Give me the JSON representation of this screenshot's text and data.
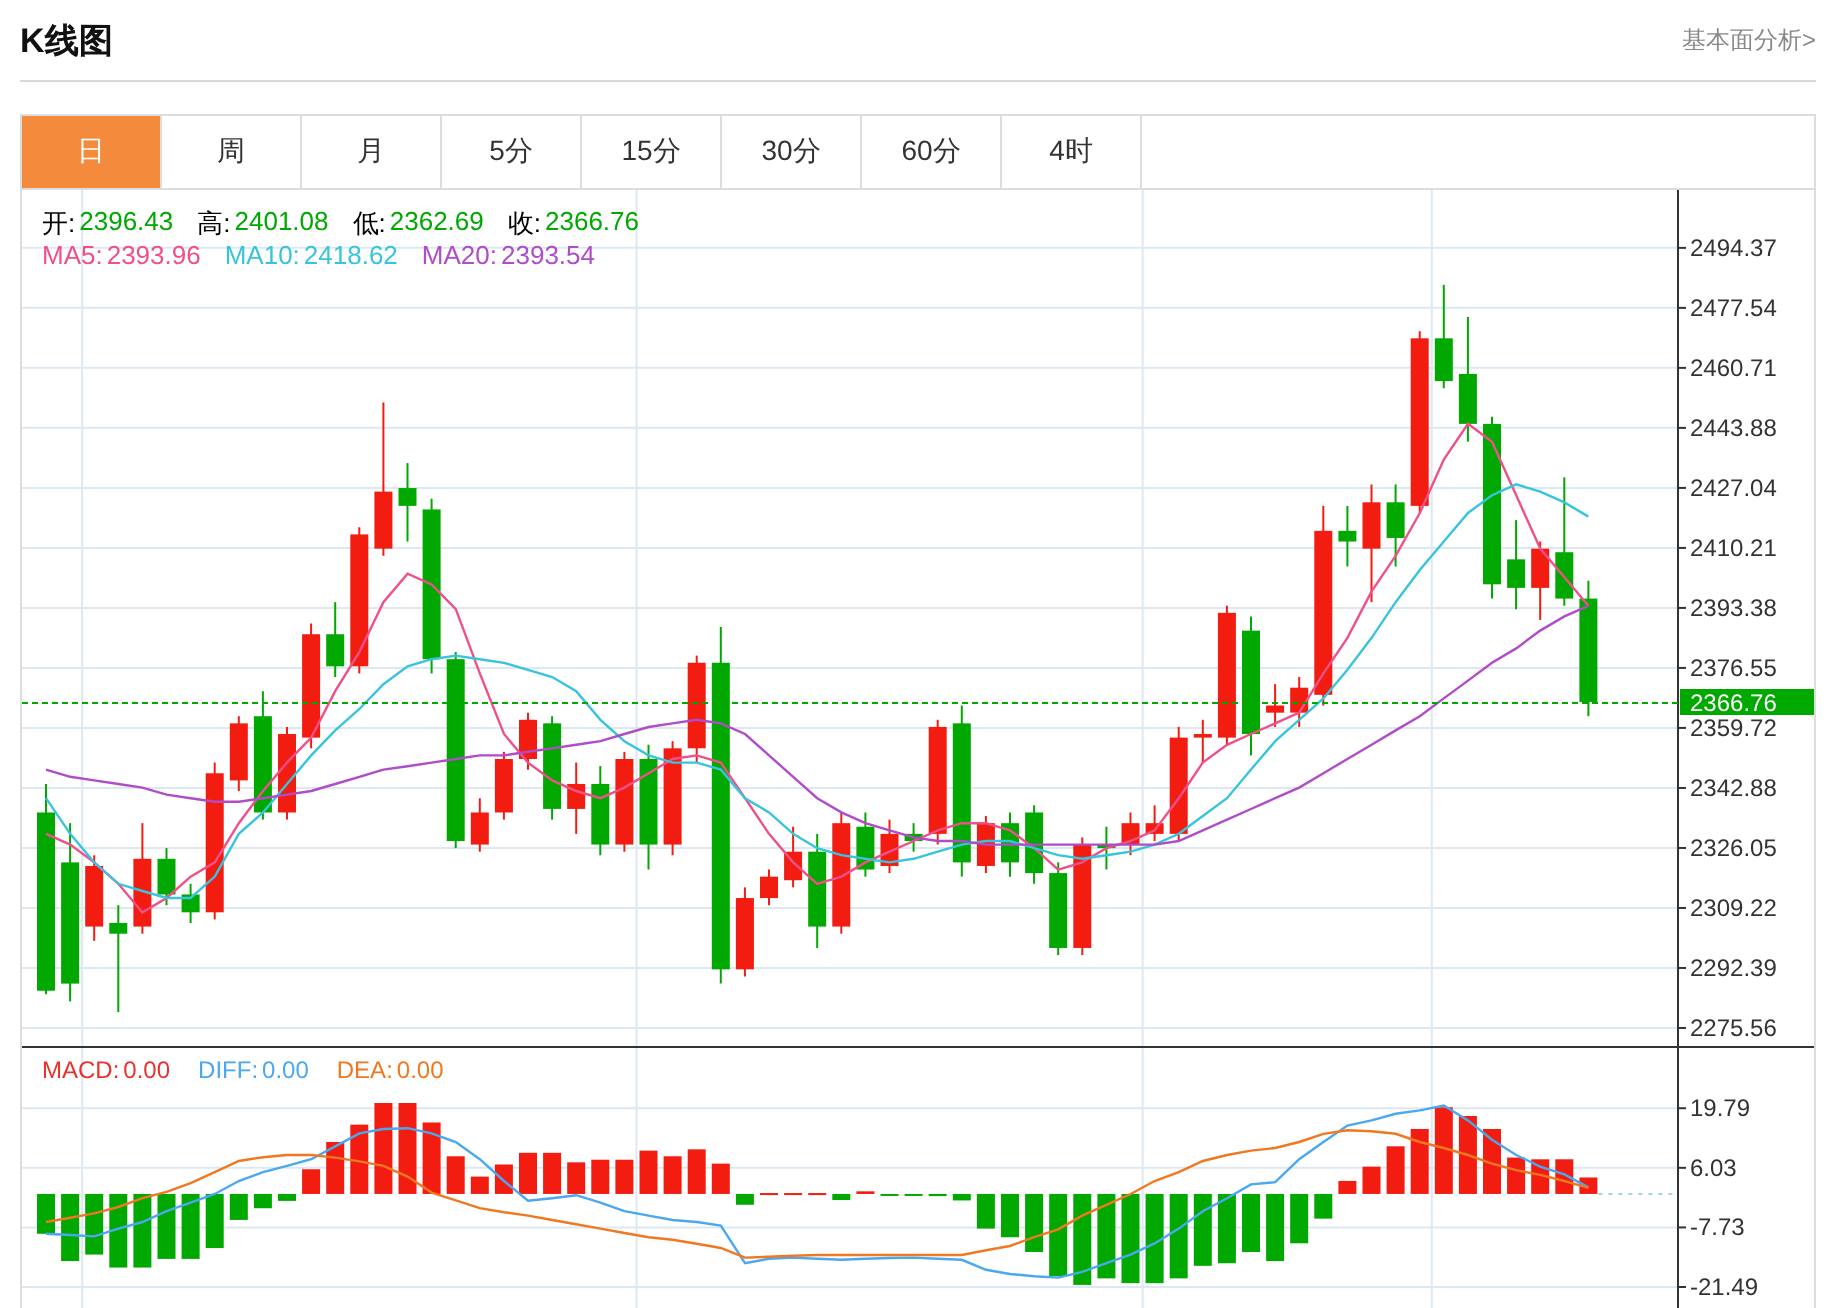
{
  "header": {
    "title": "K线图",
    "link": "基本面分析>"
  },
  "tabs": [
    {
      "label": "日",
      "selected": true
    },
    {
      "label": "周",
      "selected": false
    },
    {
      "label": "月",
      "selected": false
    },
    {
      "label": "5分",
      "selected": false
    },
    {
      "label": "15分",
      "selected": false
    },
    {
      "label": "30分",
      "selected": false
    },
    {
      "label": "60分",
      "selected": false
    },
    {
      "label": "4时",
      "selected": false
    }
  ],
  "price_panel": {
    "ohlc": [
      {
        "label": "开:",
        "value": "2396.43"
      },
      {
        "label": "高:",
        "value": "2401.08"
      },
      {
        "label": "低:",
        "value": "2362.69"
      },
      {
        "label": "收:",
        "value": "2366.76"
      }
    ],
    "ma_legend": [
      {
        "label": "MA5:",
        "value": "2393.96",
        "color": "#f0508a"
      },
      {
        "label": "MA10:",
        "value": "2418.62",
        "color": "#38c4dc"
      },
      {
        "label": "MA20:",
        "value": "2393.54",
        "color": "#b04cc8"
      }
    ],
    "chart_data": {
      "type": "candlestick",
      "grid": true,
      "ylim": [
        2270.5,
        2510.6
      ],
      "yticks": [
        {
          "value": 2494.37,
          "label": "2494.37"
        },
        {
          "value": 2477.54,
          "label": "2477.54"
        },
        {
          "value": 2460.71,
          "label": "2460.71"
        },
        {
          "value": 2443.88,
          "label": "2443.88"
        },
        {
          "value": 2427.04,
          "label": "2427.04"
        },
        {
          "value": 2410.21,
          "label": "2410.21"
        },
        {
          "value": 2393.38,
          "label": "2393.38"
        },
        {
          "value": 2376.55,
          "label": "2376.55"
        },
        {
          "value": 2359.72,
          "label": "2359.72"
        },
        {
          "value": 2342.88,
          "label": "2342.88"
        },
        {
          "value": 2326.05,
          "label": "2326.05"
        },
        {
          "value": 2309.22,
          "label": "2309.22"
        },
        {
          "value": 2292.39,
          "label": "2292.39"
        },
        {
          "value": 2275.56,
          "label": "2275.56"
        }
      ],
      "ref_lines": [
        {
          "axis": "y",
          "value": 2366.76,
          "label": "2366.76",
          "color": "#00a800"
        }
      ],
      "ohlc": [
        [
          2336,
          2344,
          2285,
          2286
        ],
        [
          2322,
          2333,
          2283,
          2288
        ],
        [
          2304,
          2324,
          2300,
          2321
        ],
        [
          2305,
          2310,
          2280,
          2302
        ],
        [
          2304,
          2333,
          2302,
          2323
        ],
        [
          2323,
          2326,
          2310,
          2313
        ],
        [
          2313,
          2316,
          2305,
          2308
        ],
        [
          2308,
          2350,
          2306,
          2347
        ],
        [
          2345,
          2363,
          2342,
          2361
        ],
        [
          2363,
          2370,
          2334,
          2336
        ],
        [
          2336,
          2360,
          2334,
          2358
        ],
        [
          2357,
          2389,
          2354,
          2386
        ],
        [
          2386,
          2395,
          2374,
          2377
        ],
        [
          2377,
          2416,
          2375,
          2414
        ],
        [
          2410,
          2451,
          2408,
          2426
        ],
        [
          2427,
          2434,
          2412,
          2422
        ],
        [
          2421,
          2424,
          2375,
          2379
        ],
        [
          2379,
          2381,
          2326,
          2328
        ],
        [
          2327,
          2340,
          2325,
          2336
        ],
        [
          2336,
          2353,
          2334,
          2351
        ],
        [
          2351,
          2364,
          2348,
          2362
        ],
        [
          2361,
          2363,
          2334,
          2337
        ],
        [
          2337,
          2350,
          2330,
          2344
        ],
        [
          2344,
          2349,
          2324,
          2327
        ],
        [
          2327,
          2353,
          2325,
          2351
        ],
        [
          2351,
          2355,
          2320,
          2327
        ],
        [
          2327,
          2356,
          2324,
          2354
        ],
        [
          2354,
          2380,
          2350,
          2378
        ],
        [
          2378,
          2388,
          2288,
          2292
        ],
        [
          2292,
          2315,
          2290,
          2312
        ],
        [
          2312,
          2320,
          2310,
          2318
        ],
        [
          2317,
          2332,
          2315,
          2325
        ],
        [
          2325,
          2330,
          2298,
          2304
        ],
        [
          2304,
          2336,
          2302,
          2333
        ],
        [
          2332,
          2336,
          2318,
          2320
        ],
        [
          2321,
          2334,
          2319,
          2330
        ],
        [
          2330,
          2333,
          2325,
          2328
        ],
        [
          2330,
          2362,
          2327,
          2360
        ],
        [
          2361,
          2366,
          2318,
          2322
        ],
        [
          2321,
          2335,
          2319,
          2333
        ],
        [
          2333,
          2336,
          2318,
          2322
        ],
        [
          2336,
          2338,
          2316,
          2319
        ],
        [
          2319,
          2322,
          2296,
          2298
        ],
        [
          2298,
          2329,
          2296,
          2327
        ],
        [
          2327,
          2332,
          2320,
          2326
        ],
        [
          2327,
          2336,
          2324,
          2333
        ],
        [
          2330,
          2338,
          2328,
          2333
        ],
        [
          2330,
          2360,
          2328,
          2357
        ],
        [
          2357,
          2362,
          2350,
          2358
        ],
        [
          2357,
          2394,
          2355,
          2392
        ],
        [
          2387,
          2391,
          2352,
          2358
        ],
        [
          2364,
          2372,
          2360,
          2366
        ],
        [
          2364,
          2374,
          2360,
          2371
        ],
        [
          2369,
          2422,
          2366,
          2415
        ],
        [
          2415,
          2422,
          2405,
          2412
        ],
        [
          2410,
          2428,
          2395,
          2423
        ],
        [
          2423,
          2428,
          2405,
          2413
        ],
        [
          2422,
          2471,
          2420,
          2469
        ],
        [
          2469,
          2484,
          2455,
          2457
        ],
        [
          2459,
          2475,
          2440,
          2445
        ],
        [
          2445,
          2447,
          2396,
          2400
        ],
        [
          2407,
          2418,
          2393,
          2399
        ],
        [
          2399,
          2412,
          2390,
          2410
        ],
        [
          2409,
          2430,
          2394,
          2396
        ],
        [
          2396,
          2401,
          2363,
          2367
        ]
      ],
      "series": [
        {
          "type": "line",
          "color": "#f0508a",
          "values": [
            2330,
            2327,
            2322,
            2316,
            2308,
            2312,
            2318,
            2322,
            2333,
            2342,
            2350,
            2357,
            2370,
            2381,
            2395,
            2403,
            2400,
            2393,
            2375,
            2358,
            2350,
            2345,
            2342,
            2340,
            2343,
            2347,
            2351,
            2352,
            2350,
            2340,
            2330,
            2322,
            2316,
            2318,
            2322,
            2325,
            2328,
            2331,
            2333,
            2333,
            2331,
            2326,
            2320,
            2322,
            2326,
            2328,
            2331,
            2340,
            2350,
            2355,
            2358,
            2361,
            2364,
            2375,
            2385,
            2398,
            2408,
            2420,
            2435,
            2445,
            2440,
            2425,
            2410,
            2402,
            2394
          ]
        },
        {
          "type": "line",
          "color": "#38c4dc",
          "values": [
            2340,
            2330,
            2322,
            2316,
            2314,
            2312,
            2312,
            2318,
            2330,
            2336,
            2344,
            2352,
            2359,
            2365,
            2372,
            2377,
            2379,
            2380,
            2379,
            2378,
            2376,
            2374,
            2370,
            2362,
            2356,
            2352,
            2350,
            2350,
            2348,
            2340,
            2336,
            2330,
            2326,
            2324,
            2323,
            2322,
            2323,
            2325,
            2327,
            2328,
            2328,
            2326,
            2324,
            2323,
            2324,
            2325,
            2327,
            2330,
            2335,
            2340,
            2348,
            2356,
            2362,
            2368,
            2376,
            2385,
            2395,
            2404,
            2412,
            2420,
            2425,
            2428,
            2426,
            2423,
            2419
          ]
        },
        {
          "type": "line",
          "color": "#b04cc8",
          "values": [
            2348,
            2346,
            2345,
            2344,
            2343,
            2341,
            2340,
            2339,
            2339,
            2340,
            2341,
            2342,
            2344,
            2346,
            2348,
            2349,
            2350,
            2351,
            2352,
            2352,
            2353,
            2354,
            2355,
            2356,
            2358,
            2360,
            2361,
            2362,
            2361,
            2358,
            2352,
            2346,
            2340,
            2336,
            2333,
            2331,
            2329,
            2328,
            2328,
            2327,
            2327,
            2327,
            2327,
            2327,
            2327,
            2327,
            2327,
            2328,
            2331,
            2334,
            2337,
            2340,
            2343,
            2347,
            2351,
            2355,
            2359,
            2363,
            2368,
            2373,
            2378,
            2382,
            2387,
            2391,
            2394
          ]
        }
      ]
    }
  },
  "macd_panel": {
    "legend": [
      {
        "label": "MACD:",
        "value": "0.00",
        "color": "#e8322b"
      },
      {
        "label": "DIFF:",
        "value": "0.00",
        "color": "#4aa8f0"
      },
      {
        "label": "DEA:",
        "value": "0.00",
        "color": "#f07820"
      }
    ],
    "chart_data": {
      "type": "bar",
      "grid": true,
      "ylim": [
        -26.8,
        33.7
      ],
      "yticks": [
        {
          "value": 19.79,
          "label": "19.79"
        },
        {
          "value": 6.03,
          "label": "6.03"
        },
        {
          "value": -7.73,
          "label": "-7.73"
        },
        {
          "value": -21.49,
          "label": "-21.49"
        }
      ],
      "series": [
        {
          "colors": [
            "#00a800",
            "#00a800",
            "#00a800",
            "#00a800",
            "#00a800",
            "#00a800",
            "#00a800",
            "#00a800",
            "#00a800",
            "#00a800",
            "#00a800",
            "#f21c10",
            "#f21c10",
            "#f21c10",
            "#f21c10",
            "#f21c10",
            "#f21c10",
            "#f21c10",
            "#f21c10",
            "#f21c10",
            "#f21c10",
            "#f21c10",
            "#f21c10",
            "#f21c10",
            "#f21c10",
            "#f21c10",
            "#f21c10",
            "#f21c10",
            "#f21c10",
            "#00a800",
            "#f21c10",
            "#f21c10",
            "#f21c10",
            "#00a800",
            "#f21c10",
            "#00a800",
            "#00a800",
            "#00a800",
            "#00a800",
            "#00a800",
            "#00a800",
            "#00a800",
            "#00a800",
            "#00a800",
            "#00a800",
            "#00a800",
            "#00a800",
            "#00a800",
            "#00a800",
            "#00a800",
            "#00a800",
            "#00a800",
            "#00a800",
            "#00a800",
            "#f21c10",
            "#f21c10",
            "#f21c10",
            "#f21c10",
            "#f21c10",
            "#f21c10",
            "#f21c10",
            "#f21c10",
            "#f21c10",
            "#f21c10",
            "#f21c10"
          ],
          "values": [
            -9.2,
            -15.5,
            -14,
            -17,
            -17,
            -15,
            -15,
            -12.5,
            -6,
            -3.3,
            -1.6,
            5.7,
            12,
            16,
            21,
            21,
            16.5,
            8.7,
            4,
            6.8,
            9.5,
            9.5,
            7.3,
            7.9,
            7.9,
            10,
            8.7,
            10.3,
            7,
            -2.5,
            0.2,
            0.2,
            0.2,
            -1.4,
            0.6,
            -0.4,
            -0.3,
            -0.5,
            -1.5,
            -8,
            -10,
            -13.4,
            -19,
            -21,
            -19.5,
            -20.6,
            -20.6,
            -19.5,
            -16.6,
            -16,
            -13.4,
            -15.5,
            -11.4,
            -5.7,
            3,
            6.3,
            11,
            15,
            20,
            18,
            15,
            8.4,
            8,
            8,
            3.8
          ]
        },
        {
          "type": "line",
          "color": "#4aa8f0",
          "values": [
            -9.2,
            -9.5,
            -9.8,
            -8,
            -6.5,
            -4,
            -2,
            0,
            3,
            5,
            6.5,
            8,
            11,
            14,
            15,
            15.2,
            14,
            12,
            8,
            3,
            -1.6,
            -1,
            -0.3,
            -2,
            -4,
            -5,
            -6,
            -6.5,
            -7.3,
            -16,
            -15,
            -14.7,
            -15,
            -15.2,
            -15,
            -14.8,
            -14.7,
            -15,
            -15.2,
            -17.5,
            -18.5,
            -19,
            -19.3,
            -18,
            -16,
            -14,
            -11.4,
            -8,
            -4,
            -1,
            2.2,
            2.7,
            8,
            12,
            15.8,
            17,
            18.5,
            19.3,
            20.4,
            17,
            12.5,
            9,
            6.3,
            4.5,
            1.5
          ]
        },
        {
          "type": "line",
          "color": "#f07820",
          "values": [
            -6.5,
            -5.5,
            -4.5,
            -3,
            -1,
            0.5,
            2.5,
            5,
            7.6,
            8.5,
            9,
            9,
            8.4,
            7.5,
            6.5,
            4,
            0.3,
            -1.5,
            -3.3,
            -4.2,
            -5,
            -6,
            -7,
            -8,
            -9,
            -10,
            -10.6,
            -11.5,
            -12.5,
            -14.7,
            -14.5,
            -14.3,
            -14.1,
            -14.1,
            -14.1,
            -14.1,
            -14.1,
            -14.1,
            -14.1,
            -13,
            -12,
            -10,
            -8.2,
            -5,
            -2.5,
            0,
            3,
            5,
            7.6,
            9,
            10,
            10.6,
            12,
            13.9,
            14.7,
            14.5,
            13.9,
            12,
            10.6,
            9,
            7,
            5.5,
            4.4,
            3,
            1.4
          ]
        }
      ]
    }
  }
}
